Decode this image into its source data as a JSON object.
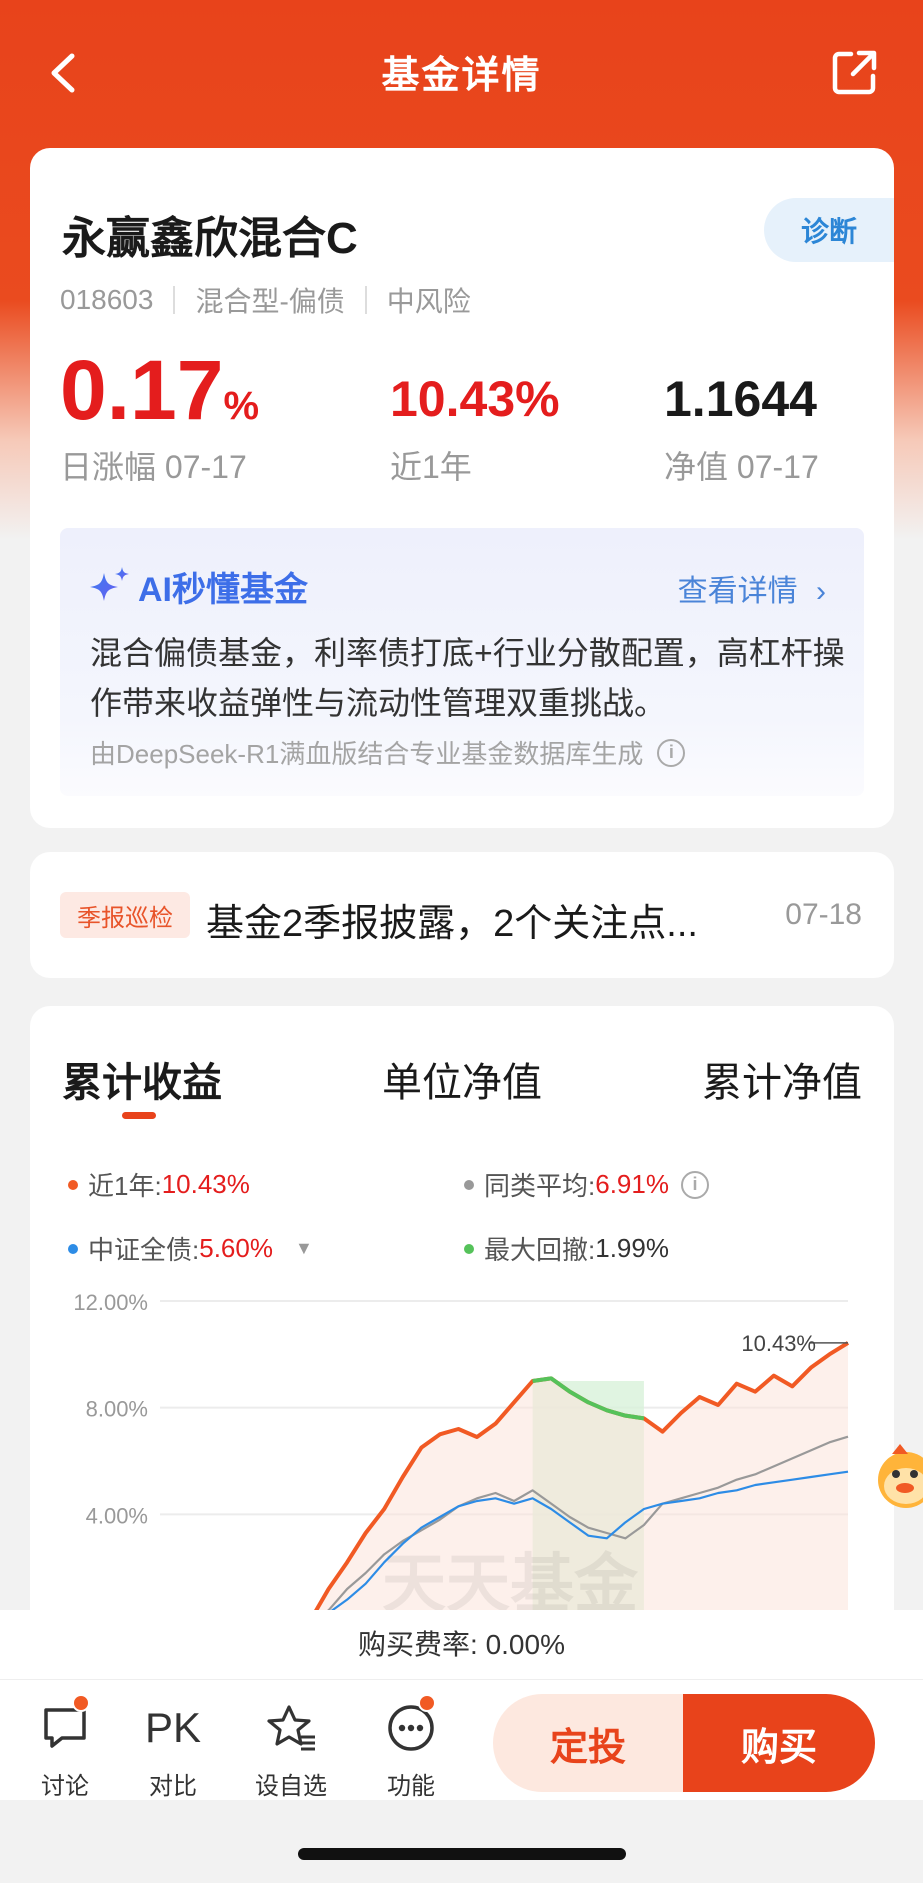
{
  "nav": {
    "title": "基金详情"
  },
  "fund": {
    "name": "永赢鑫欣混合C",
    "diagnose_label": "诊断",
    "code": "018603",
    "type": "混合型-偏债",
    "risk": "中风险",
    "daily_change": "0.17",
    "daily_change_unit": "%",
    "daily_change_label": "日涨幅 07-17",
    "one_year_return": "10.43%",
    "one_year_label": "近1年",
    "nav_value": "1.1644",
    "nav_label": "净值 07-17"
  },
  "ai": {
    "title": "AI秒懂基金",
    "more": "查看详情",
    "summary": "混合偏债基金，利率债打底+行业分散配置，高杠杆操作带来收益弹性与流动性管理双重挑战。",
    "note": "由DeepSeek-R1满血版结合专业基金数据库生成"
  },
  "report": {
    "tag": "季报巡检",
    "text": "基金2季报披露，2个关注点...",
    "date": "07-18"
  },
  "chart_tabs": [
    "累计收益",
    "单位净值",
    "累计净值"
  ],
  "legend": [
    {
      "label": "近1年:",
      "value": "10.43%",
      "color": "#f15a24"
    },
    {
      "label": "同类平均:",
      "value": "6.91%",
      "color": "#999999"
    },
    {
      "label": "中证全债:",
      "value": "5.60%",
      "color": "#2d8ce6"
    },
    {
      "label": "最大回撤:",
      "value": "1.99%",
      "color": "#55c25a"
    }
  ],
  "chart_data": {
    "type": "line",
    "y_ticks": [
      "12.00%",
      "8.00%",
      "4.00%"
    ],
    "end_label": "10.43%",
    "watermark": "天天基金",
    "ylim": [
      0,
      12
    ],
    "series": [
      {
        "name": "近1年",
        "color": "#f15a24",
        "values": [
          0.0,
          1.2,
          2.2,
          3.3,
          4.2,
          5.4,
          6.5,
          7.0,
          7.2,
          6.9,
          7.4,
          8.2,
          9.0,
          9.1,
          8.6,
          8.2,
          7.9,
          7.7,
          7.6,
          7.1,
          7.8,
          8.4,
          8.1,
          8.9,
          8.6,
          9.2,
          8.8,
          9.5,
          10.0,
          10.43
        ]
      },
      {
        "name": "同类平均",
        "color": "#999999",
        "values": [
          0.0,
          0.4,
          1.2,
          1.8,
          2.5,
          3.0,
          3.4,
          3.8,
          4.3,
          4.6,
          4.8,
          4.5,
          4.9,
          4.4,
          3.9,
          3.5,
          3.3,
          3.1,
          3.6,
          4.4,
          4.6,
          4.8,
          5.0,
          5.3,
          5.5,
          5.8,
          6.1,
          6.4,
          6.7,
          6.91
        ]
      },
      {
        "name": "中证全债",
        "color": "#2d8ce6",
        "values": [
          0.0,
          0.3,
          0.8,
          1.4,
          2.2,
          2.9,
          3.5,
          3.9,
          4.3,
          4.5,
          4.6,
          4.4,
          4.6,
          4.2,
          3.7,
          3.2,
          3.1,
          3.7,
          4.2,
          4.4,
          4.5,
          4.6,
          4.8,
          4.9,
          5.1,
          5.2,
          5.3,
          5.4,
          5.5,
          5.6
        ]
      }
    ],
    "max_drawdown_range": [
      12,
      18
    ]
  },
  "fee": {
    "text": "购买费率: 0.00%"
  },
  "toolbar": {
    "discuss": "讨论",
    "pk_icon": "PK",
    "compare": "对比",
    "watchlist": "设自选",
    "functions": "功能",
    "fixed_invest": "定投",
    "buy": "购买"
  }
}
